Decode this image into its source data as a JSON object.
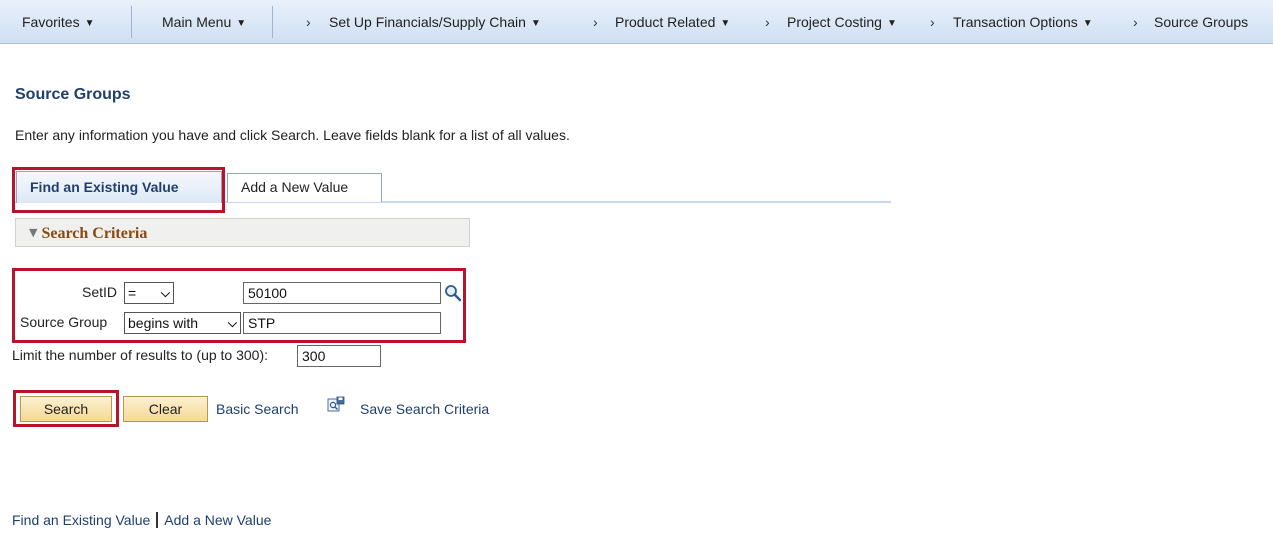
{
  "nav": {
    "favorites": "Favorites",
    "main_menu": "Main Menu",
    "crumbs": [
      "Set Up Financials/Supply Chain",
      "Product Related",
      "Project Costing",
      "Transaction Options",
      "Source Groups"
    ]
  },
  "page": {
    "title": "Source Groups",
    "instructions": "Enter any information you have and click Search. Leave fields blank for a list of all values."
  },
  "tabs": {
    "find": "Find an Existing Value",
    "add": "Add a New Value"
  },
  "search_criteria": {
    "header": "Search Criteria",
    "setid_label": "SetID",
    "setid_operator": "=",
    "setid_value": "50100",
    "source_group_label": "Source Group",
    "source_group_operator": "begins with",
    "source_group_value": "STP",
    "limit_label": "Limit the number of results to (up to 300):",
    "limit_value": "300"
  },
  "actions": {
    "search": "Search",
    "clear": "Clear",
    "basic_search": "Basic Search",
    "save_search": "Save Search Criteria"
  },
  "footer": {
    "find": "Find an Existing Value",
    "add": "Add a New Value"
  },
  "colors": {
    "highlight": "#b7142c",
    "title": "#1f3f6e",
    "group_header": "#8b4a10",
    "button": "#f5d993"
  }
}
